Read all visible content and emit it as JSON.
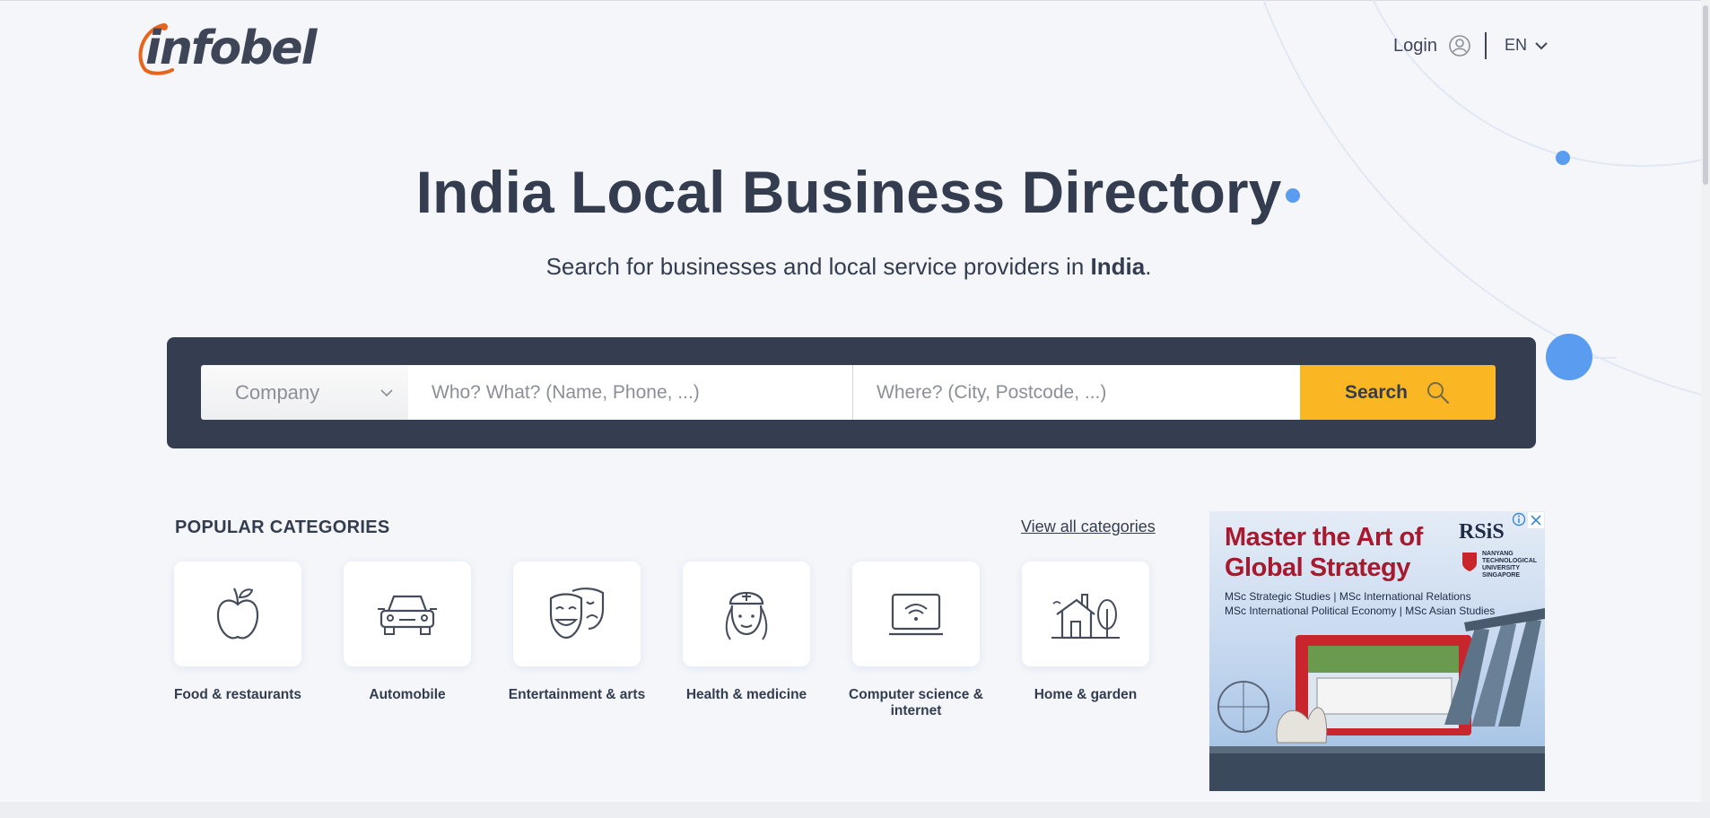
{
  "header": {
    "logo_text": "infobel",
    "login_label": "Login",
    "language": "EN"
  },
  "hero": {
    "title_bold": "India",
    "title_rest": " Local Business Directory",
    "subtitle_before": "Search for businesses and local service providers in ",
    "subtitle_bold": "India",
    "subtitle_after": "."
  },
  "search": {
    "type_selected": "Company",
    "who_placeholder": "Who? What? (Name, Phone, ...)",
    "where_placeholder": "Where? (City, Postcode, ...)",
    "button_label": "Search"
  },
  "categories": {
    "heading": "POPULAR CATEGORIES",
    "view_all": "View all categories",
    "items": [
      {
        "label": "Food & restaurants",
        "icon": "apple-icon"
      },
      {
        "label": "Automobile",
        "icon": "car-icon"
      },
      {
        "label": "Entertainment & arts",
        "icon": "theater-masks-icon"
      },
      {
        "label": "Health & medicine",
        "icon": "nurse-icon"
      },
      {
        "label": "Computer science & internet",
        "icon": "laptop-wifi-icon"
      },
      {
        "label": "Home & garden",
        "icon": "house-tree-icon"
      }
    ]
  },
  "ad": {
    "headline_1": "Master the Art of",
    "headline_2": "Global Strategy",
    "line_1": "MSc Strategic Studies  |  MSc International Relations",
    "line_2": "MSc International Political Economy  |  MSc Asian Studies",
    "brand": "RSiS",
    "university": "NANYANG TECHNOLOGICAL UNIVERSITY SINGAPORE"
  },
  "colors": {
    "search_bar": "#353e51",
    "search_button": "#fbb624",
    "text": "#333d4f",
    "logo_accent": "#e8641c",
    "deco_blue": "#5a9df0"
  }
}
